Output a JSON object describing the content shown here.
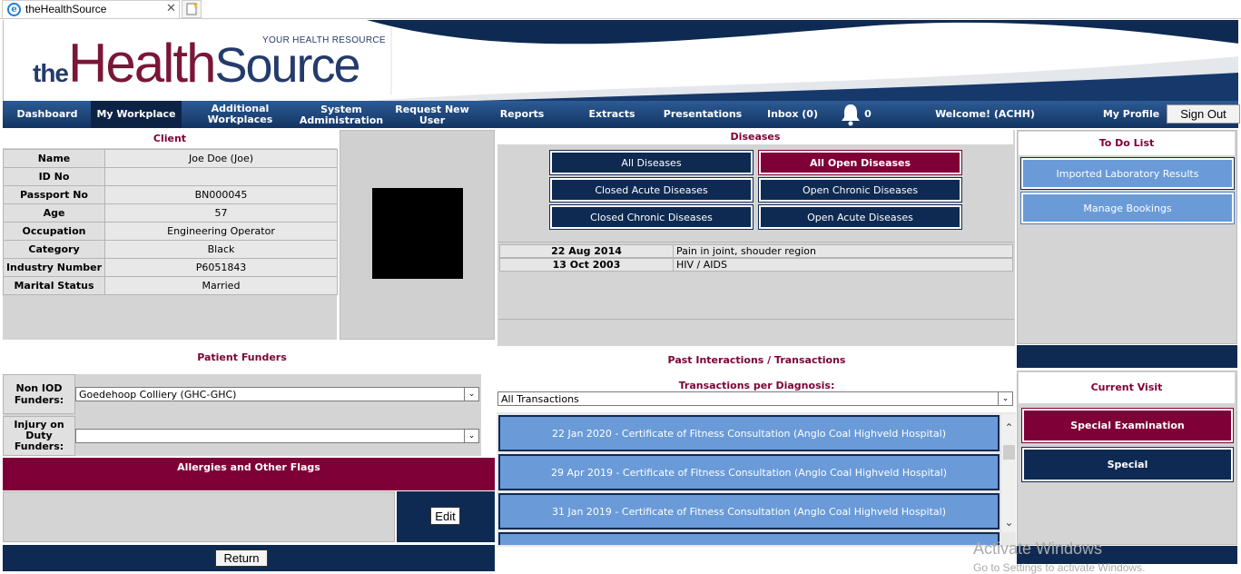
{
  "browser": {
    "tab_title": "theHealthSource"
  },
  "logo": {
    "tagline": "YOUR HEALTH RESOURCE",
    "the": "the",
    "health": "Health",
    "source": "Source"
  },
  "nav": {
    "items": [
      "Dashboard",
      "My Workplace",
      "Additional Workplaces",
      "System Administration",
      "Request New User",
      "Reports",
      "Extracts",
      "Presentations",
      "Inbox (0)"
    ],
    "active": "My Workplace",
    "bell_count": "0",
    "welcome": "Welcome! (ACHH)",
    "my_profile": "My Profile",
    "sign_out": "Sign Out"
  },
  "client": {
    "title": "Client",
    "rows": [
      {
        "label": "Name",
        "value": "Joe Doe (Joe)"
      },
      {
        "label": "ID No",
        "value": ""
      },
      {
        "label": "Passport No",
        "value": "BN000045"
      },
      {
        "label": "Age",
        "value": "57"
      },
      {
        "label": "Occupation",
        "value": "Engineering Operator"
      },
      {
        "label": "Category",
        "value": "Black"
      },
      {
        "label": "Industry Number",
        "value": "P6051843"
      },
      {
        "label": "Marital Status",
        "value": "Married"
      }
    ]
  },
  "funders": {
    "title": "Patient Funders",
    "non_iod_label": "Non IOD Funders:",
    "non_iod_value": "Goedehoop Colliery (GHC-GHC)",
    "iod_label": "Injury on Duty Funders:",
    "iod_value": ""
  },
  "allergies": {
    "title": "Allergies and Other Flags",
    "edit": "Edit",
    "return": "Return"
  },
  "diseases": {
    "title": "Diseases",
    "buttons": [
      "All Diseases",
      "All Open Diseases",
      "Closed Acute Diseases",
      "Open Chronic Diseases",
      "Closed Chronic Diseases",
      "Open Acute Diseases"
    ],
    "rows": [
      {
        "date": "22 Aug 2014",
        "desc": "Pain in joint, shouder region"
      },
      {
        "date": "13 Oct 2003",
        "desc": "HIV / AIDS"
      }
    ]
  },
  "interactions": {
    "title": "Past Interactions / Transactions",
    "subtitle": "Transactions per Diagnosis:",
    "filter": "All Transactions",
    "items": [
      "22 Jan 2020 - Certificate of Fitness Consultation (Anglo Coal Highveld Hospital)",
      "29 Apr 2019 - Certificate of Fitness Consultation (Anglo Coal Highveld Hospital)",
      "31 Jan 2019 - Certificate of Fitness Consultation (Anglo Coal Highveld Hospital)"
    ]
  },
  "todo": {
    "title": "To Do List",
    "items": [
      "Imported Laboratory Results",
      "Manage Bookings"
    ]
  },
  "visit": {
    "title": "Current Visit",
    "primary": "Special Examination",
    "secondary": "Special"
  },
  "os": {
    "watermark1": "Activate Windows",
    "watermark2": "Go to Settings to activate Windows."
  }
}
